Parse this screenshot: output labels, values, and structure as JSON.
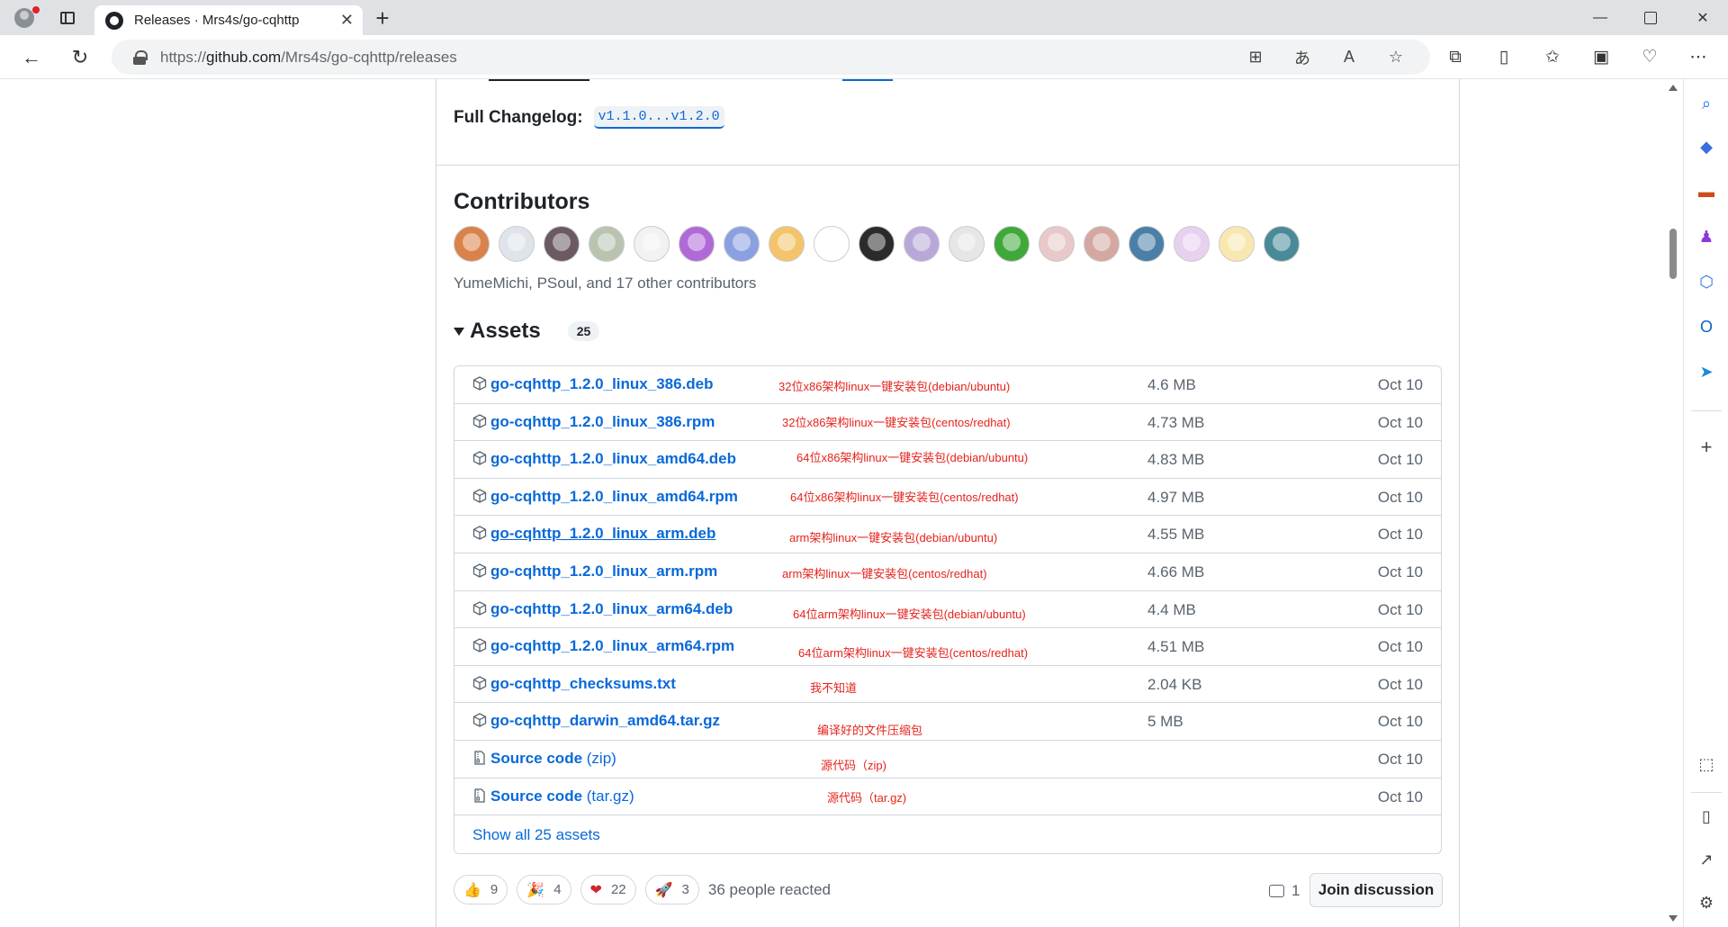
{
  "browser": {
    "tab_title": "Releases · Mrs4s/go-cqhttp",
    "url_prefix": "https://",
    "url_host": "github.com",
    "url_path": "/Mrs4s/go-cqhttp/releases"
  },
  "release": {
    "changelog_label": "Full Changelog:",
    "changelog_link": "v1.1.0...v1.2.0",
    "contributors_title": "Contributors",
    "contributors_text": "YumeMichi, PSoul, and 17 other contributors",
    "avatar_colors": [
      "#d9824a",
      "#dfe4ea",
      "#6b5a64",
      "#b8c4b0",
      "#f2f2f2",
      "#b06ad8",
      "#8aa0e0",
      "#f4c46a",
      "#ffffff",
      "#2b2b2b",
      "#b8a8d8",
      "#e6e6e6",
      "#3fa83a",
      "#e8c8c8",
      "#d4a8a0",
      "#4a7fa8",
      "#e8d0f0",
      "#f8e8b0",
      "#4a8a98"
    ]
  },
  "assets": {
    "title": "Assets",
    "count": "25",
    "rows": [
      {
        "name": "go-cqhttp_1.2.0_linux_386.deb",
        "sub": "",
        "note": "32位x86架构linux一键安装包(debian/ubuntu)",
        "size": "4.6 MB",
        "date": "Oct 10",
        "icon": "package-icon"
      },
      {
        "name": "go-cqhttp_1.2.0_linux_386.rpm",
        "sub": "",
        "note": "32位x86架构linux一键安装包(centos/redhat)",
        "size": "4.73 MB",
        "date": "Oct 10",
        "icon": "package-icon"
      },
      {
        "name": "go-cqhttp_1.2.0_linux_amd64.deb",
        "sub": "",
        "note": "64位x86架构linux一键安装包(debian/ubuntu)",
        "size": "4.83 MB",
        "date": "Oct 10",
        "icon": "package-icon"
      },
      {
        "name": "go-cqhttp_1.2.0_linux_amd64.rpm",
        "sub": "",
        "note": "64位x86架构linux一键安装包(centos/redhat)",
        "size": "4.97 MB",
        "date": "Oct 10",
        "icon": "package-icon"
      },
      {
        "name": "go-cqhttp_1.2.0_linux_arm.deb",
        "sub": "",
        "note": "arm架构linux一键安装包(debian/ubuntu)",
        "size": "4.55 MB",
        "date": "Oct 10",
        "icon": "package-icon"
      },
      {
        "name": "go-cqhttp_1.2.0_linux_arm.rpm",
        "sub": "",
        "note": "arm架构linux一键安装包(centos/redhat)",
        "size": "4.66 MB",
        "date": "Oct 10",
        "icon": "package-icon"
      },
      {
        "name": "go-cqhttp_1.2.0_linux_arm64.deb",
        "sub": "",
        "note": "64位arm架构linux一键安装包(debian/ubuntu)",
        "size": "4.4 MB",
        "date": "Oct 10",
        "icon": "package-icon"
      },
      {
        "name": "go-cqhttp_1.2.0_linux_arm64.rpm",
        "sub": "",
        "note": "64位arm架构linux一键安装包(centos/redhat)",
        "size": "4.51 MB",
        "date": "Oct 10",
        "icon": "package-icon"
      },
      {
        "name": "go-cqhttp_checksums.txt",
        "sub": "",
        "note": "我不知道",
        "size": "2.04 KB",
        "date": "Oct 10",
        "icon": "package-icon"
      },
      {
        "name": "go-cqhttp_darwin_amd64.tar.gz",
        "sub": "",
        "note": "编译好的文件压缩包",
        "size": "5 MB",
        "date": "Oct 10",
        "icon": "package-icon"
      },
      {
        "name": "Source code",
        "sub": " (zip)",
        "note": "源代码（zip)",
        "size": "",
        "date": "Oct 10",
        "icon": "file-zip-icon"
      },
      {
        "name": "Source code",
        "sub": " (tar.gz)",
        "note": "源代码（tar.gz)",
        "size": "",
        "date": "Oct 10",
        "icon": "file-zip-icon"
      }
    ],
    "show_all": "Show all 25 assets"
  },
  "reactions": {
    "items": [
      {
        "emoji": "👍",
        "count": "9"
      },
      {
        "emoji": "🎉",
        "count": "4"
      },
      {
        "emoji": "❤",
        "count": "22"
      },
      {
        "emoji": "🚀",
        "count": "3"
      }
    ],
    "summary": "36 people reacted",
    "comments": "1",
    "join_label": "Join discussion"
  }
}
